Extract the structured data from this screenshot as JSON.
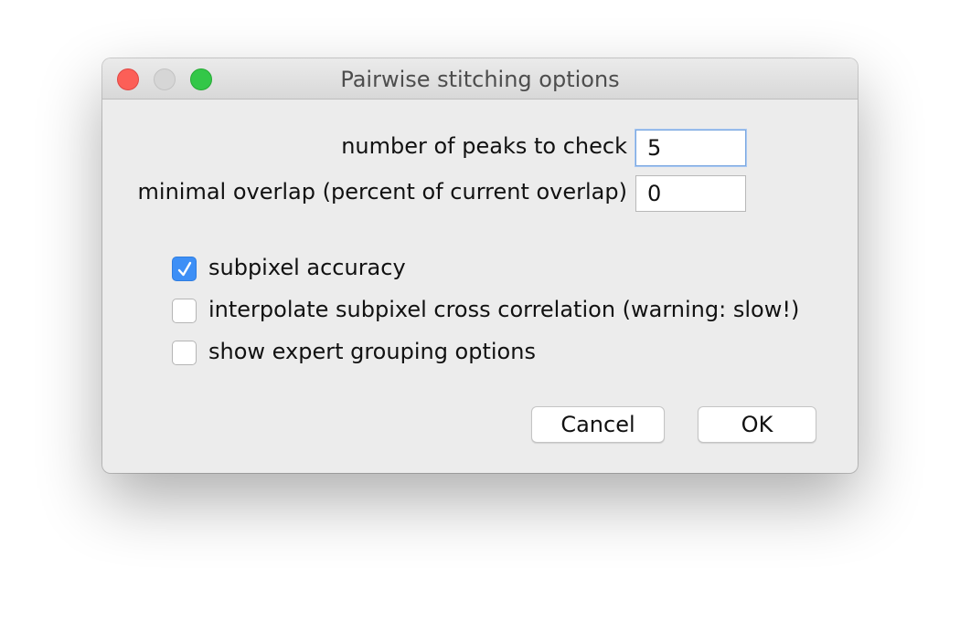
{
  "window": {
    "title": "Pairwise stitching options"
  },
  "fields": [
    {
      "label": "number of peaks to check",
      "value": "5"
    },
    {
      "label": "minimal overlap (percent of current overlap)",
      "value": "0"
    }
  ],
  "checkboxes": [
    {
      "label": "subpixel accuracy",
      "checked": true
    },
    {
      "label": "interpolate subpixel cross correlation (warning: slow!)",
      "checked": false
    },
    {
      "label": "show expert grouping options",
      "checked": false
    }
  ],
  "buttons": {
    "cancel": "Cancel",
    "ok": "OK"
  },
  "colors": {
    "accent": "#3d8ff6",
    "close": "#fc5f57",
    "zoom": "#33c748"
  }
}
